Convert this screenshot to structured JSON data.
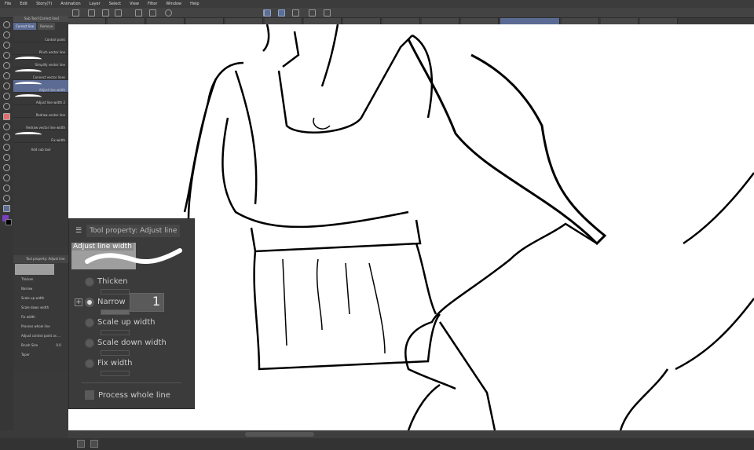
{
  "menu": [
    "File",
    "Edit",
    "Story(Y)",
    "Animation",
    "Layer",
    "Select",
    "View",
    "Filter",
    "Window",
    "Help"
  ],
  "subtool_panel": {
    "header": "Sub Tool [Correct line]",
    "tabs": [
      "Correct line",
      "Remove"
    ],
    "items": [
      "Control point",
      "Pinch vector line",
      "Simplify vector line",
      "Connect vector lines",
      "Adjust line width",
      "Adjust line width 2",
      "Redraw vector line",
      "Redraw vector line width",
      "Fix width"
    ],
    "selected": "Adjust line width",
    "add_label": "Add sub tool"
  },
  "lower_panel": {
    "title": "Tool property: Adjust line",
    "rows": [
      "Thicken",
      "Narrow",
      "Scale up width",
      "Scale down width",
      "Fix width",
      "Process whole line",
      "Adjust control point as ...",
      "Brush Size",
      "Taper"
    ],
    "brush_size": "0.0"
  },
  "popup": {
    "title": "Tool property: Adjust line",
    "preview_label": "Adjust line width",
    "options": [
      "Thicken",
      "Narrow",
      "Scale up width",
      "Scale down width",
      "Fix width"
    ],
    "selected": "Narrow",
    "narrow_value": "1",
    "checkbox_label": "Process whole line",
    "checkbox_checked": false
  },
  "colors": {
    "accent": "#5b6b93",
    "main_color": "#7b3fc4",
    "sub_color": "#000000"
  }
}
